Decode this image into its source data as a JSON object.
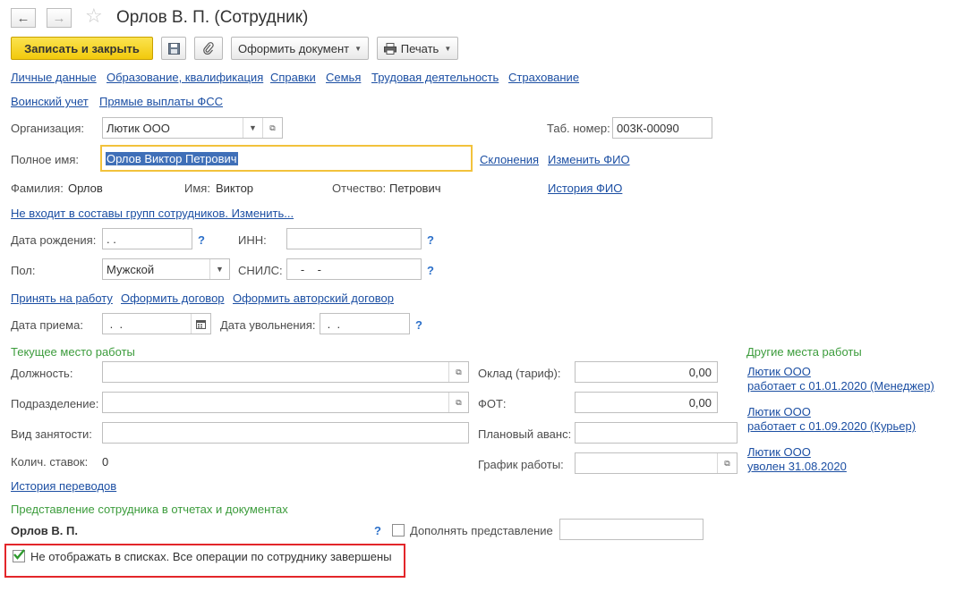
{
  "window": {
    "title": "Орлов В. П. (Сотрудник)"
  },
  "toolbar": {
    "save_close": "Записать и закрыть",
    "create_doc": "Оформить документ",
    "print": "Печать"
  },
  "tabs": [
    "Личные данные",
    "Образование, квалификация",
    "Справки",
    "Семья",
    "Трудовая деятельность",
    "Страхование",
    "Воинский учет",
    "Прямые выплаты ФСС"
  ],
  "org": {
    "label": "Организация:",
    "value": "Лютик ООО"
  },
  "tab_number": {
    "label": "Таб. номер:",
    "value": "003К-00090"
  },
  "full_name": {
    "label": "Полное имя:",
    "value": "Орлов Виктор Петрович",
    "link_declensions": "Склонения",
    "link_change": "Изменить ФИО"
  },
  "surname": {
    "label": "Фамилия:",
    "value": "Орлов"
  },
  "name": {
    "label": "Имя:",
    "value": "Виктор"
  },
  "patronymic": {
    "label": "Отчество:",
    "value": "Петрович"
  },
  "history_fio": "История ФИО",
  "groups_link": "Не входит в составы групп сотрудников. Изменить...",
  "birth": {
    "label": "Дата рождения:",
    "value": " .  ."
  },
  "inn": {
    "label": "ИНН:",
    "value": ""
  },
  "gender": {
    "label": "Пол:",
    "value": "Мужской"
  },
  "snils": {
    "label": "СНИЛС:",
    "value": "   -    -"
  },
  "hire_links": [
    "Принять на работу",
    "Оформить договор",
    "Оформить авторский договор"
  ],
  "hire_date": {
    "label": "Дата приема:",
    "value": " .  ."
  },
  "dismissal_date": {
    "label": "Дата увольнения:",
    "value": " .  ."
  },
  "current_work": {
    "header": "Текущее место работы",
    "position_label": "Должность:",
    "department_label": "Подразделение:",
    "employment_label": "Вид занятости:",
    "rates_label": "Колич. ставок:",
    "rates_value": "0",
    "salary_label": "Оклад (тариф):",
    "salary_value": "0,00",
    "fot_label": "ФОТ:",
    "fot_value": "0,00",
    "advance_label": "Плановый аванс:",
    "schedule_label": "График работы:"
  },
  "other_work": {
    "header": "Другие места работы",
    "items": [
      {
        "org": "Лютик ООО",
        "detail": "работает с 01.01.2020 (Менеджер)"
      },
      {
        "org": "Лютик ООО",
        "detail": "работает с 01.09.2020 (Курьер)"
      },
      {
        "org": "Лютик ООО",
        "detail": "уволен 31.08.2020"
      }
    ]
  },
  "transfer_history": "История переводов",
  "representation": {
    "header": "Представление сотрудника в отчетах и документах",
    "value": "Орлов В. П.",
    "supplement_label": "Дополнять представление"
  },
  "hide_in_lists": {
    "label": "Не отображать в списках. Все операции по сотруднику завершены",
    "checked": true
  },
  "help_mark": "?",
  "colors": {
    "accent": "#f2c90c",
    "link": "#1c4fa3",
    "section": "#3c9c3c",
    "highlight": "#e3262a"
  }
}
